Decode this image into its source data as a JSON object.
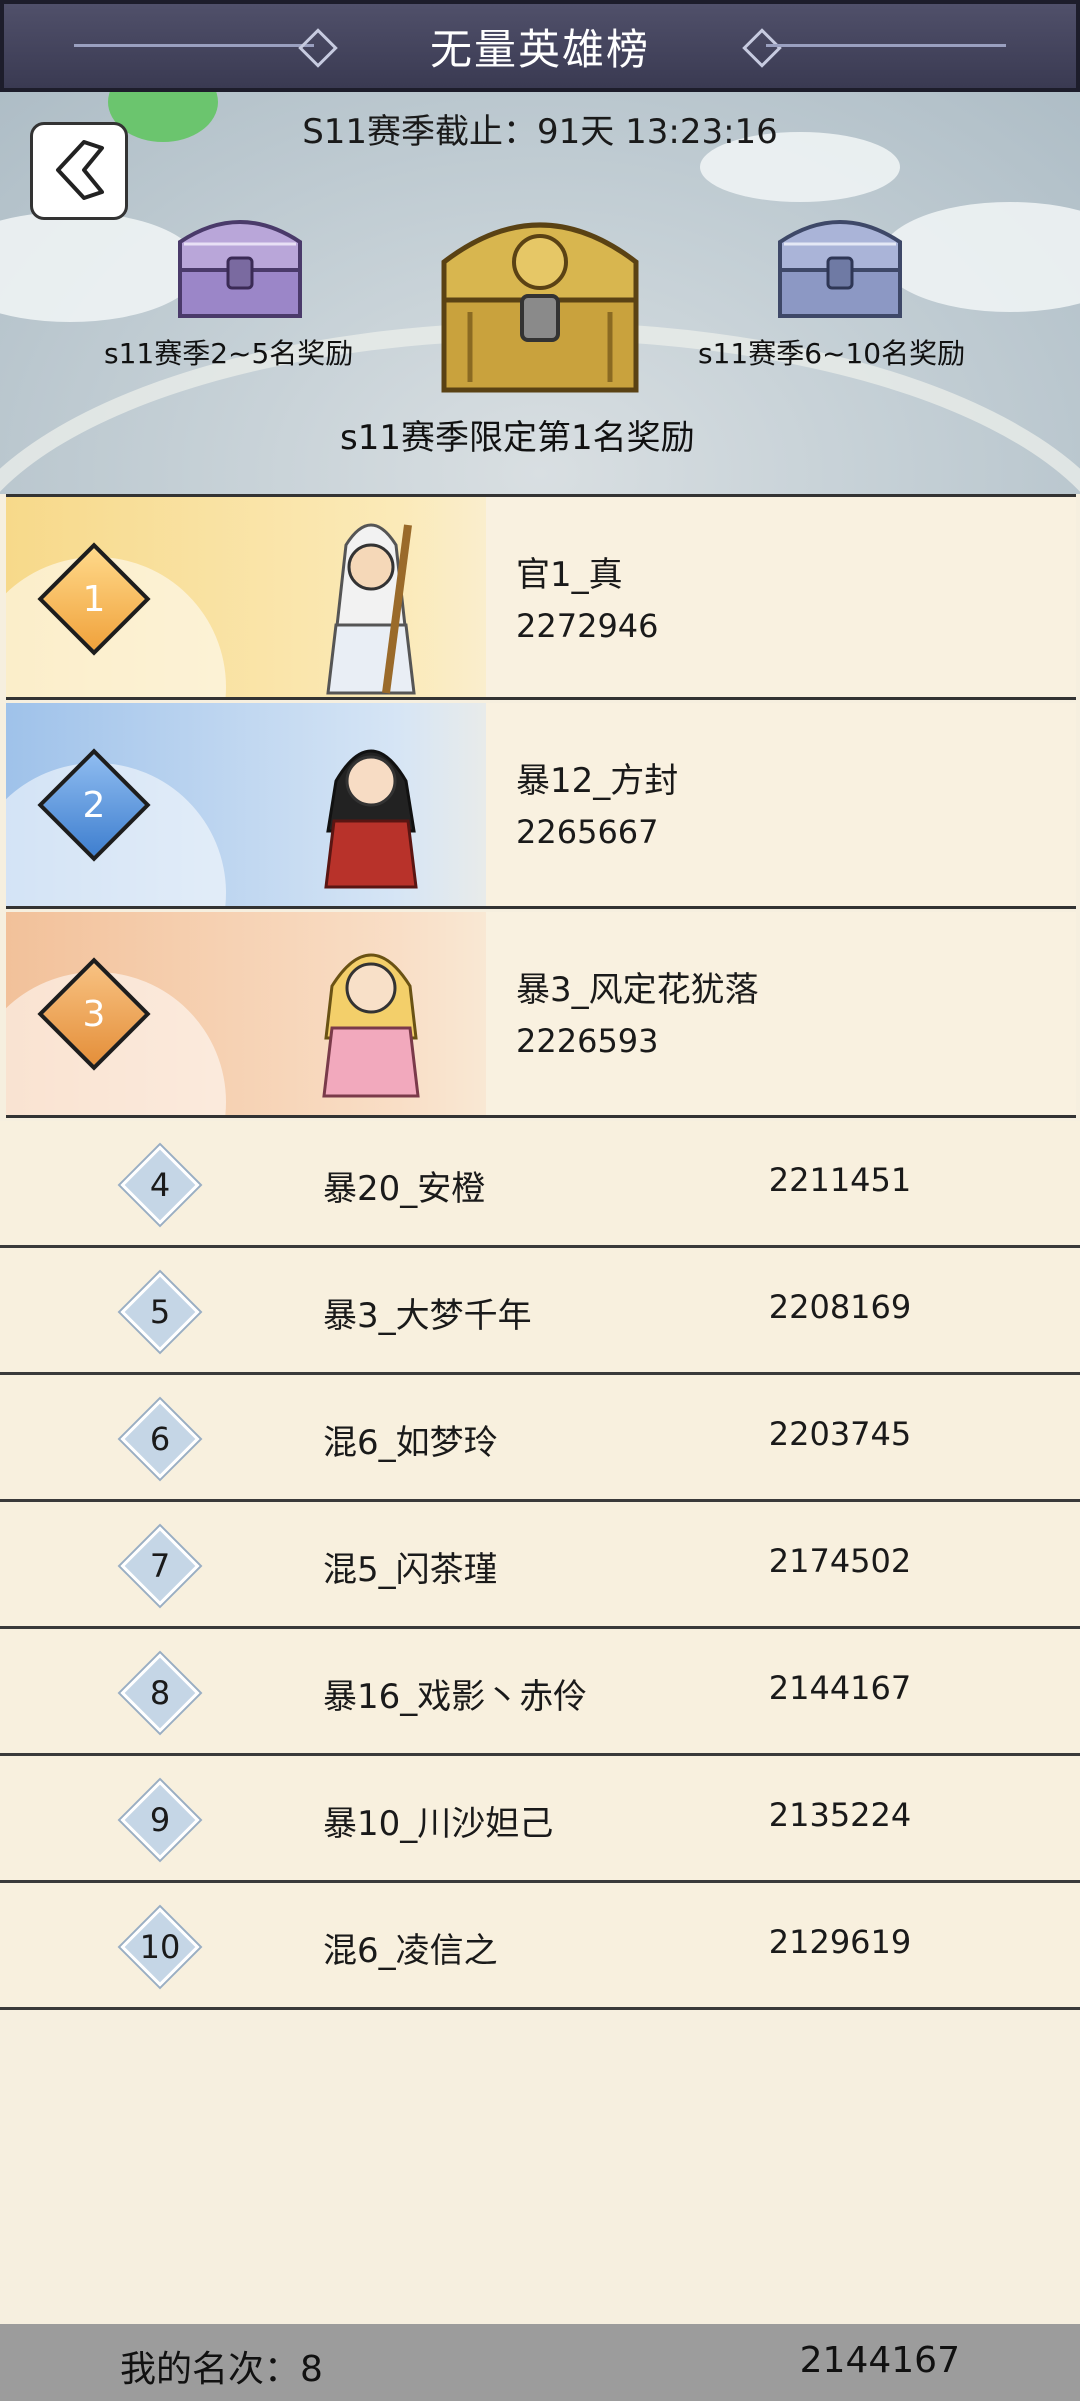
{
  "title": "无量英雄榜",
  "season_deadline": "S11赛季截止：91天 13:23:16",
  "rewards": {
    "left_label": "s11赛季2~5名奖励",
    "right_label": "s11赛季6~10名奖励",
    "main_label": "s11赛季限定第1名奖励"
  },
  "top3": [
    {
      "rank": "1",
      "name": "官1_真",
      "score": "2272946"
    },
    {
      "rank": "2",
      "name": "暴12_方封",
      "score": "2265667"
    },
    {
      "rank": "3",
      "name": "暴3_风定花犹落",
      "score": "2226593"
    }
  ],
  "rows": [
    {
      "rank": "4",
      "name": "暴20_安橙",
      "score": "2211451"
    },
    {
      "rank": "5",
      "name": "暴3_大梦千年",
      "score": "2208169"
    },
    {
      "rank": "6",
      "name": "混6_如梦玲",
      "score": "2203745"
    },
    {
      "rank": "7",
      "name": "混5_闪茶瑾",
      "score": "2174502"
    },
    {
      "rank": "8",
      "name": "暴16_戏影丶赤伶",
      "score": "2144167"
    },
    {
      "rank": "9",
      "name": "暴10_川沙妲己",
      "score": "2135224"
    },
    {
      "rank": "10",
      "name": "混6_凌信之",
      "score": "2129619"
    }
  ],
  "my_rank": {
    "label": "我的名次：8",
    "score": "2144167"
  },
  "colors": {
    "gold": "#f2b04a",
    "blue": "#4f8fd4",
    "bronze": "#f0a454",
    "titlebar": "#45455e"
  }
}
